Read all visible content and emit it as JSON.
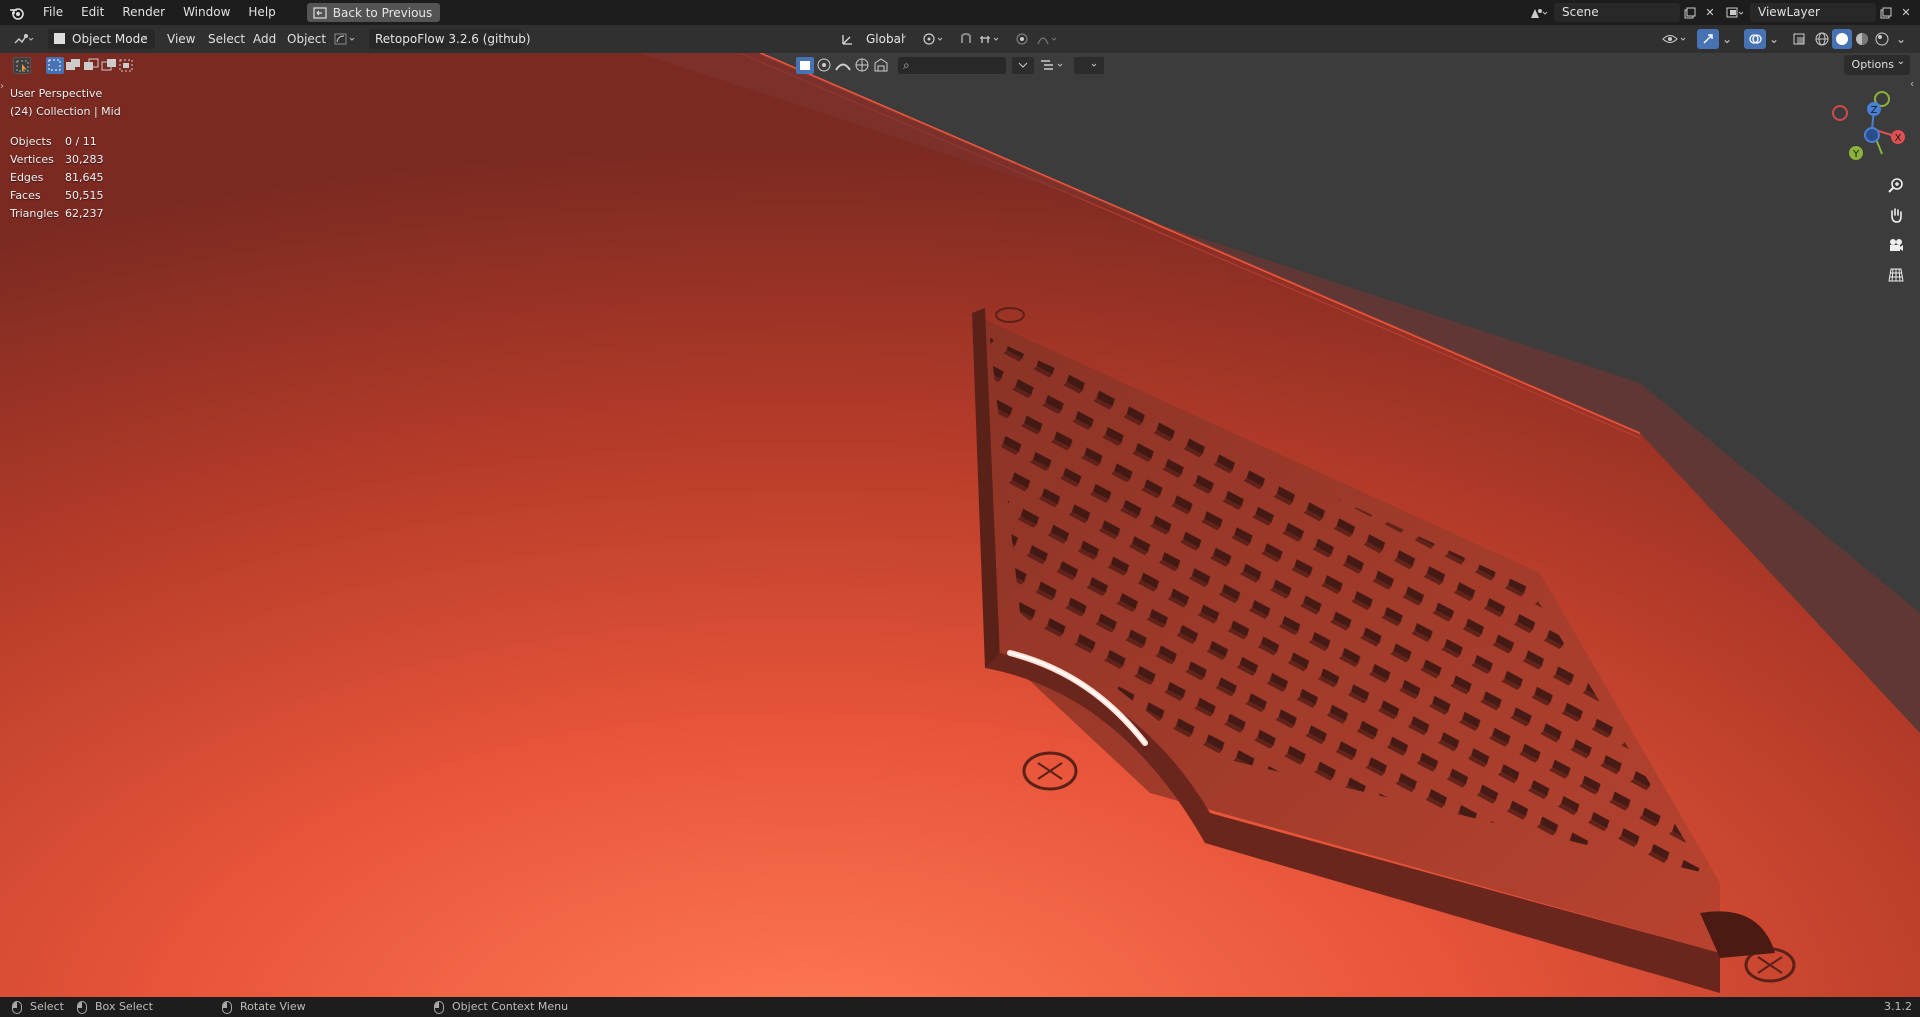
{
  "menu": {
    "items": [
      "File",
      "Edit",
      "Render",
      "Window",
      "Help"
    ],
    "back_button": "Back to Previous"
  },
  "scene": {
    "label": "Scene",
    "view_layer": "ViewLayer"
  },
  "header": {
    "mode": "Object Mode",
    "view": "View",
    "select": "Select",
    "add": "Add",
    "object": "Object",
    "addon": "RetopoFlow 3.2.6 (github)",
    "orientation": "Global"
  },
  "viewport": {
    "perspective": "User Perspective",
    "collection": "(24) Collection | Mid",
    "options": "Options",
    "search_placeholder": "",
    "stats": [
      {
        "label": "Objects",
        "value": "0 / 11"
      },
      {
        "label": "Vertices",
        "value": "30,283"
      },
      {
        "label": "Edges",
        "value": "81,645"
      },
      {
        "label": "Faces",
        "value": "50,515"
      },
      {
        "label": "Triangles",
        "value": "62,237"
      }
    ],
    "gizmo": {
      "x": "X",
      "y": "Y",
      "z": "Z"
    }
  },
  "statusbar": {
    "select": "Select",
    "box_select": "Box Select",
    "rotate_view": "Rotate View",
    "context_menu": "Object Context Menu",
    "version": "3.1.2"
  },
  "colors": {
    "topbar": "#1d1d1d",
    "header": "#303030",
    "viewport_bg": "#3a3a3a",
    "model_orange": "#e8553a",
    "accent_blue": "#4772b3"
  }
}
